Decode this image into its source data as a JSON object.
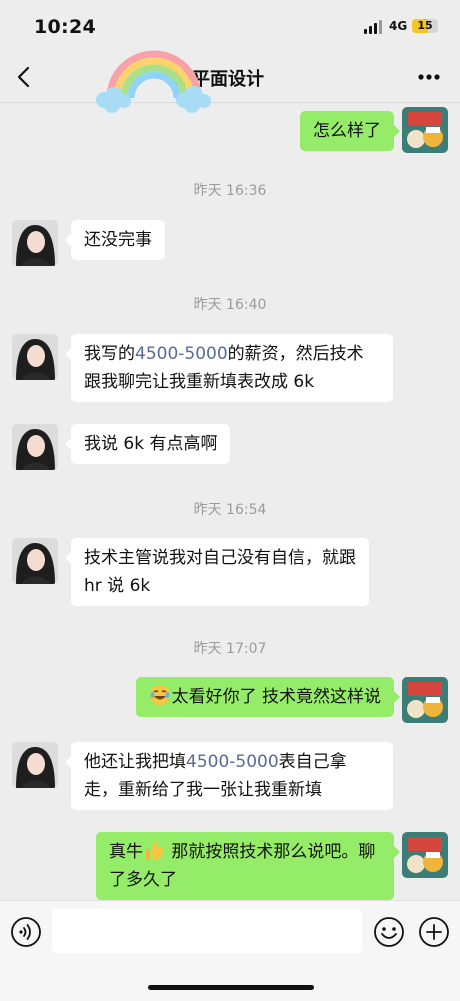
{
  "status_bar": {
    "time": "10:24",
    "network": "4G",
    "battery": "15",
    "battery_level": 0.15
  },
  "header": {
    "title": "辰平面设计"
  },
  "messages": [
    {
      "type": "text",
      "side": "right",
      "parts": [
        {
          "t": "怎么样了"
        }
      ]
    },
    {
      "type": "timestamp",
      "text": "昨天 16:36"
    },
    {
      "type": "text",
      "side": "left",
      "parts": [
        {
          "t": "还没完事"
        }
      ]
    },
    {
      "type": "timestamp",
      "text": "昨天 16:40"
    },
    {
      "type": "text",
      "side": "left",
      "parts": [
        {
          "t": "我写的"
        },
        {
          "t": "4500-5000",
          "hl": true
        },
        {
          "t": "的薪资，然后技术跟我聊完让我重新填表改成 6k"
        }
      ]
    },
    {
      "type": "text",
      "side": "left",
      "parts": [
        {
          "t": "我说 6k 有点高啊"
        }
      ]
    },
    {
      "type": "timestamp",
      "text": "昨天 16:54"
    },
    {
      "type": "text",
      "side": "left",
      "parts": [
        {
          "t": " 技术主管说我对自己没有自信，就跟 hr 说 6k"
        }
      ]
    },
    {
      "type": "timestamp",
      "text": "昨天 17:07"
    },
    {
      "type": "text",
      "side": "right",
      "emoji": "crying-laughing-emoji",
      "parts": [
        {
          "t": "太看好你了 技术竟然这样说"
        }
      ]
    },
    {
      "type": "text",
      "side": "left",
      "parts": [
        {
          "t": "他还让我把填"
        },
        {
          "t": "4500-5000",
          "hl": true
        },
        {
          "t": "表自己拿走，重新给了我一张让我重新填"
        }
      ]
    },
    {
      "type": "text",
      "side": "right",
      "emoji_inline": "thumbs-up-emoji",
      "parts": [
        {
          "t": "真牛"
        },
        {
          "emoji": "thumbs-up"
        },
        {
          "t": " 那就按照技术那么说吧。聊了多久了"
        }
      ]
    }
  ],
  "input_bar": {
    "placeholder": "",
    "icons": [
      "voice-icon",
      "sticker-icon",
      "plus-icon"
    ]
  },
  "colors": {
    "background": "#ededed",
    "bubble_right": "#95ec69",
    "bubble_left": "#ffffff",
    "highlight": "#576b95"
  }
}
